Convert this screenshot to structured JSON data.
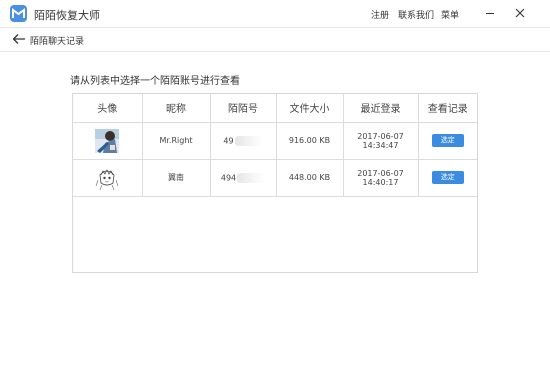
{
  "app": {
    "title": "陌陌恢复大师",
    "menu": [
      "注册",
      "联系我们",
      "菜单"
    ]
  },
  "nav": {
    "title": "陌陌聊天记录"
  },
  "instruction": "请从列表中选择一个陌陌账号进行查看",
  "table": {
    "headers": [
      "头像",
      "昵称",
      "陌陌号",
      "文件大小",
      "最近登录",
      "查看记录"
    ],
    "rows": [
      {
        "nickname": "Mr.Right",
        "id": "49",
        "size": "916.00 KB",
        "last_login": "2017-06-07 14:34:47",
        "action": "选定"
      },
      {
        "nickname": "翼南",
        "id": "494",
        "size": "448.00 KB",
        "last_login": "2017-06-07 14:40:17",
        "action": "选定"
      }
    ]
  },
  "colors": {
    "accent": "#3b8be0",
    "logo": "#4a90e2"
  }
}
